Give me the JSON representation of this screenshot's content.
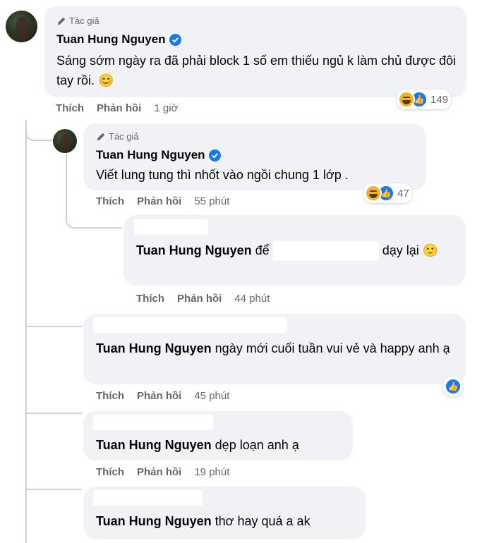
{
  "comments": [
    {
      "badge": "Tác giả",
      "name": "Tuan Hung Nguyen",
      "text": "Sáng sớm ngày ra đã phải block 1 số em thiếu ngủ k làm chủ được đôi tay rồi. 😊",
      "actions": {
        "like": "Thích",
        "reply": "Phản hồi",
        "time": "1 giờ"
      },
      "reaction_count": "149"
    },
    {
      "badge": "Tác giả",
      "name": "Tuan Hung Nguyen",
      "text": "Viết lung tung thì nhốt vào ngồi chung 1 lớp .",
      "actions": {
        "like": "Thích",
        "reply": "Phản hồi",
        "time": "55 phút"
      },
      "reaction_count": "47"
    },
    {
      "mention": "Tuan Hung Nguyen",
      "text_before": "để",
      "text_after": "dạy lại 🙂",
      "actions": {
        "like": "Thích",
        "reply": "Phản hồi",
        "time": "44 phút"
      }
    },
    {
      "mention": "Tuan Hung Nguyen",
      "text": "ngày mới cuối tuần vui vẻ và happy anh ạ",
      "actions": {
        "like": "Thích",
        "reply": "Phản hồi",
        "time": "45 phút"
      }
    },
    {
      "mention": "Tuan Hung Nguyen",
      "text": "dẹp loạn anh ạ",
      "actions": {
        "like": "Thích",
        "reply": "Phản hồi",
        "time": "19 phút"
      }
    },
    {
      "mention": "Tuan Hung Nguyen",
      "text": "thơ hay quá a ak"
    }
  ],
  "colors": {
    "bubble": "#f0f2f5",
    "secondary_text": "#65676b",
    "verified_blue": "#1877f2",
    "thread_line": "#ced0d4"
  },
  "icons": [
    "pencil-icon",
    "verified-badge-icon",
    "haha-reaction-icon",
    "like-reaction-icon"
  ]
}
